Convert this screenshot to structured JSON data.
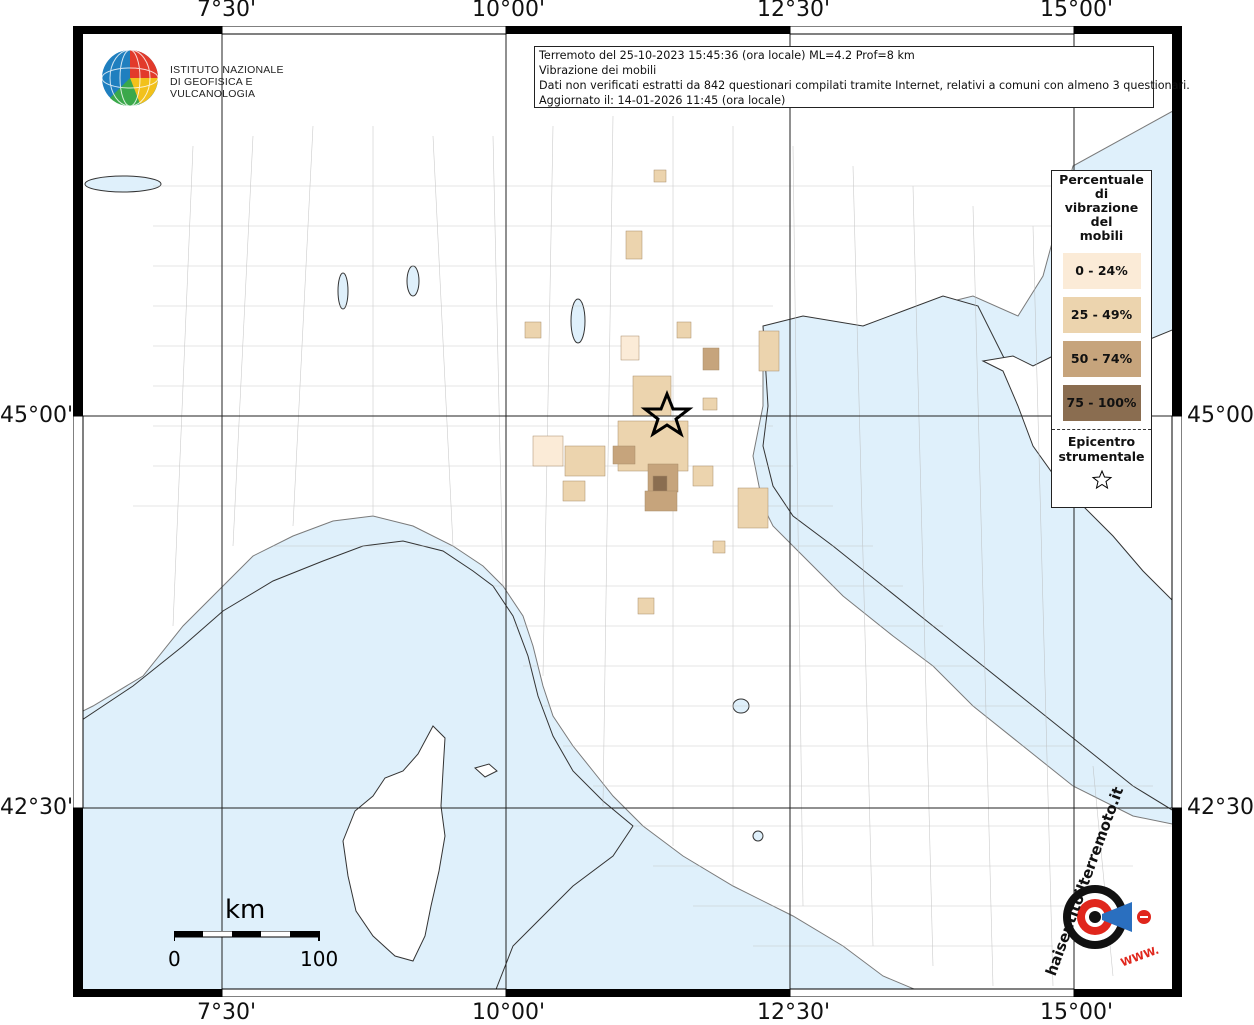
{
  "info": {
    "line1": "Terremoto del 25-10-2023 15:45:36 (ora locale) ML=4.2 Prof=8 km",
    "line2": "Vibrazione dei mobili",
    "line3": "Dati non verificati estratti da 842 questionari compilati tramite Internet, relativi a comuni con almeno 3 questionari.",
    "line4": "Aggiornato il: 14-01-2026 11:45 (ora locale)"
  },
  "axes": {
    "top": [
      "7°30'",
      "10°00'",
      "12°30'",
      "15°00'"
    ],
    "bottom": [
      "7°30'",
      "10°00'",
      "12°30'",
      "15°00'"
    ],
    "left": [
      "45°00'",
      "42°30'"
    ],
    "right": [
      "45°00'",
      "42°30'"
    ]
  },
  "legend": {
    "title": "Percentuale di vibrazione del mobili",
    "title_lines": [
      "Percentuale",
      "di",
      "vibrazione",
      "del",
      "mobili"
    ],
    "classes": [
      {
        "label": "0 - 24%",
        "color": "#fbebd7"
      },
      {
        "label": "25 - 49%",
        "color": "#ecd4ae"
      },
      {
        "label": "50 - 74%",
        "color": "#c6a47c"
      },
      {
        "label": "75 - 100%",
        "color": "#8a6d50"
      }
    ],
    "epicenter_lines": [
      "Epicentro",
      "strumentale"
    ]
  },
  "scale": {
    "unit": "km",
    "min": "0",
    "max": "100"
  },
  "logo": {
    "org_line1": "ISTITUTO NAZIONALE",
    "org_line2": "DI GEOFISICA E VULCANOLOGIA",
    "hsit": "haisentitoilterremoto.it",
    "hsit_www": "WWW."
  },
  "colors": {
    "sea": "#dff0fb",
    "land": "#ffffff",
    "border": "#9a9a9a",
    "grid": "#222222"
  }
}
